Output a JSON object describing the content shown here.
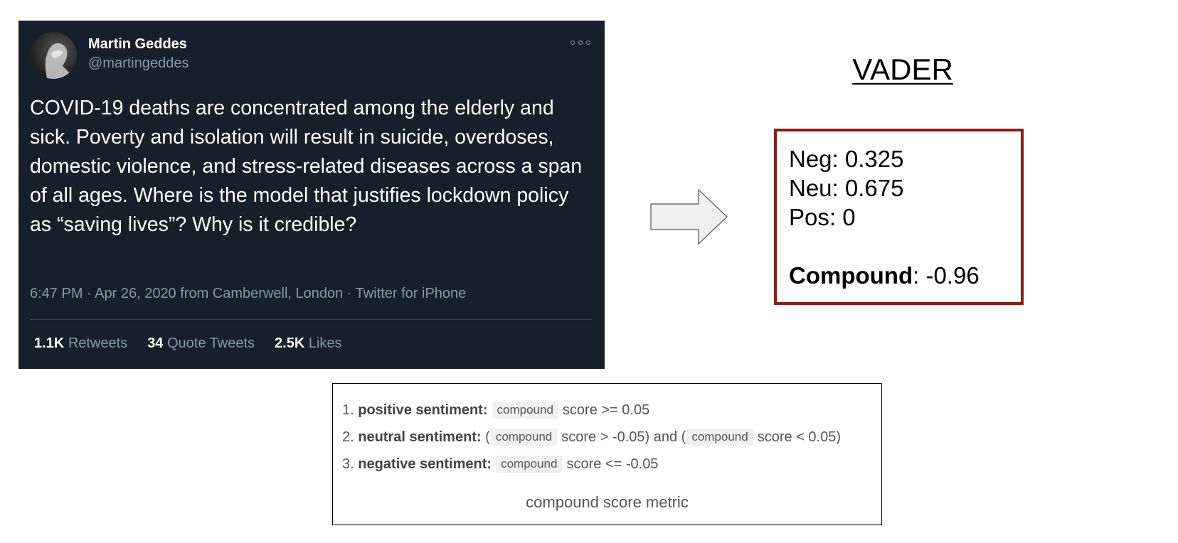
{
  "tweet": {
    "user_name": "Martin Geddes",
    "handle": "@martingeddes",
    "text": "COVID-19 deaths are concentrated among the elderly and sick. Poverty and isolation will result in suicide, overdoses, domestic violence, and stress-related diseases across a span of all ages. Where is the model that justifies lockdown policy as “saving lives”? Why is it credible?",
    "meta": "6:47 PM · Apr 26, 2020 from Camberwell, London · Twitter for iPhone",
    "stats": {
      "retweets_count": "1.1K",
      "retweets_label": "Retweets",
      "quotes_count": "34",
      "quotes_label": "Quote Tweets",
      "likes_count": "2.5K",
      "likes_label": "Likes"
    },
    "icons": {
      "menu": "more-horizontal-icon",
      "avatar": "profile-photo"
    },
    "colors": {
      "background": "#15202b",
      "secondary_text": "#8899a6"
    }
  },
  "vader": {
    "title": "VADER",
    "neg_label": "Neg",
    "neg_value": "0.325",
    "neu_label": "Neu",
    "neu_value": "0.675",
    "pos_label": "Pos",
    "pos_value": "0",
    "compound_label": "Compound",
    "compound_value": "-0.96",
    "border_color": "#8b1d17"
  },
  "metric": {
    "rules": [
      {
        "num": "1.",
        "label": "positive sentiment:",
        "code": "compound",
        "rest": "score >= 0.05"
      },
      {
        "num": "2.",
        "label": "neutral sentiment:",
        "open": "(",
        "code": "compound",
        "mid": "score > -0.05) and (",
        "code2": "compound",
        "rest": "score < 0.05)"
      },
      {
        "num": "3.",
        "label": "negative sentiment:",
        "code": "compound",
        "rest": "score <= -0.05"
      }
    ],
    "caption": "compound score metric"
  }
}
